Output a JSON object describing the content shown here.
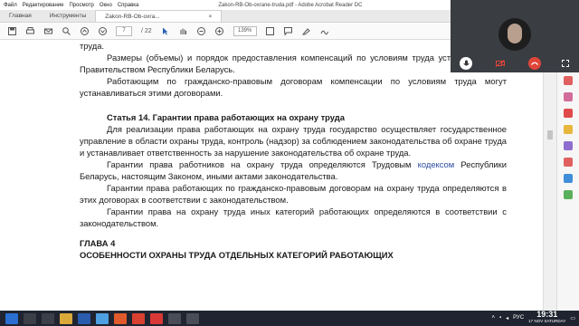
{
  "menu": [
    "Файл",
    "Редактирование",
    "Просмотр",
    "Окно",
    "Справка"
  ],
  "window_title": "Zakon-RB-Ob-oxrane-truda.pdf - Adobe Acrobat Reader DC",
  "tabs": {
    "home": "Главная",
    "tools": "Инструменты",
    "doc": "Zakon-RB-Ob-oxra...",
    "close": "×"
  },
  "toolbar": {
    "page_current": "7",
    "page_total": "/ 22",
    "zoom": "139%"
  },
  "document": {
    "line0": "труда.",
    "p1": "Размеры (объемы) и порядок предоставления компенсаций по условиям труда устанавливаются Правительством Республики Беларусь.",
    "p2": "Работающим по гражданско-правовым договорам компенсации по условиям труда могут устанавливаться этими договорами.",
    "heading": "Статья 14. Гарантии права работающих на охрану труда",
    "p3": "Для реализации права работающих на охрану труда государство осуществляет государственное управление в области охраны труда, контроль (надзор) за соблюдением законодательства об охране труда и устанавливает ответственность за нарушение законодательства об охране труда.",
    "p4_a": "Гарантии права работников на охрану труда определяются Трудовым ",
    "p4_link": "кодексом",
    "p4_b": " Республики Беларусь, настоящим Законом, иными актами законодательства.",
    "p5": "Гарантии права работающих по гражданско-правовым договорам на охрану труда определяются в этих договорах в соответствии с законодательством.",
    "p6": "Гарантии права на охрану труда иных категорий работающих определяются в соответствии с законодательством.",
    "chapter": "ГЛАВА 4",
    "chapter_title": "ОСОБЕННОСТИ ОХРАНЫ ТРУДА ОТДЕЛЬНЫХ КАТЕГОРИЙ РАБОТАЮЩИХ"
  },
  "taskbar": {
    "lang": "РУС",
    "time": "19:31",
    "date": "17",
    "month": "NOV",
    "weekday": "SATURDAY"
  },
  "colors": {
    "accent_red": "#e0453a",
    "link": "#2a4a9e",
    "taskbar": "#1f2430"
  }
}
